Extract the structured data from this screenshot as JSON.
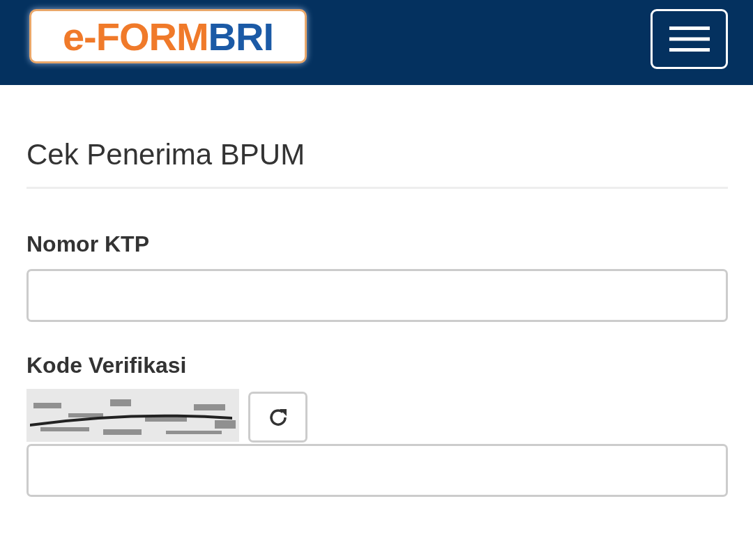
{
  "header": {
    "logo": [
      {
        "text": "e-FORM",
        "color": "#f07a2a"
      },
      {
        "text": "BRI",
        "color": "#1b5aa6"
      }
    ]
  },
  "title": "Cek Penerima BPUM",
  "fields": [
    {
      "kind": "text",
      "label": "Nomor KTP"
    },
    {
      "kind": "captcha",
      "label": "Kode Verifikasi"
    }
  ]
}
